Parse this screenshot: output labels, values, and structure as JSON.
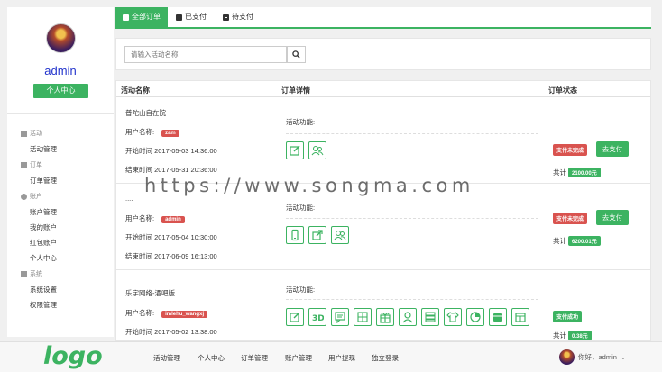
{
  "sidebar": {
    "username": "admin",
    "profile_button": "个人中心",
    "groups": [
      {
        "label": "活动",
        "items": [
          "活动管理"
        ]
      },
      {
        "label": "订单",
        "items": [
          "订单管理"
        ]
      },
      {
        "label": "账户",
        "items": [
          "账户管理",
          "我的账户",
          "红包账户",
          "个人中心"
        ]
      },
      {
        "label": "系统",
        "items": [
          "系统设置",
          "权限管理"
        ]
      }
    ]
  },
  "tabs": {
    "all": "全部订单",
    "paid": "已支付",
    "pending": "待支付"
  },
  "search": {
    "placeholder": "请输入活动名称"
  },
  "table": {
    "headers": {
      "name": "活动名称",
      "detail": "订单详情",
      "status": "订单状态"
    },
    "user_label": "用户名称:",
    "func_label": "活动功能:",
    "total_label": "共计",
    "rows": [
      {
        "title": "普陀山自在院",
        "user": "zam",
        "start": "开始时间 2017-05-03 14:36:00",
        "end": "结束时间 2017-05-31 20:36:00",
        "status": "支付未完成",
        "action": "去支付",
        "amount": "2100.00元"
      },
      {
        "title": "....",
        "user": "admin",
        "start": "开始时间 2017-05-04 10:30:00",
        "end": "结束时间 2017-06-09 16:13:00",
        "status": "支付未完成",
        "action": "去支付",
        "amount": "6200.01元"
      },
      {
        "title": "乐宇网络-酒吧版",
        "user": "imlehu_wangxj",
        "start": "开始时间 2017-05-02 13:38:00",
        "end": "",
        "status": "支付成功",
        "action": "",
        "amount": "0.38元"
      }
    ]
  },
  "watermark": "https://www.songma.com",
  "bottom": {
    "logo": "logo",
    "nav": [
      "活动管理",
      "个人中心",
      "订单管理",
      "账户管理",
      "用户提现",
      "独立登录"
    ],
    "greeting": "你好，admin"
  },
  "colors": {
    "accent": "#3cb361",
    "danger": "#d9534f",
    "username": "#2233cc"
  }
}
